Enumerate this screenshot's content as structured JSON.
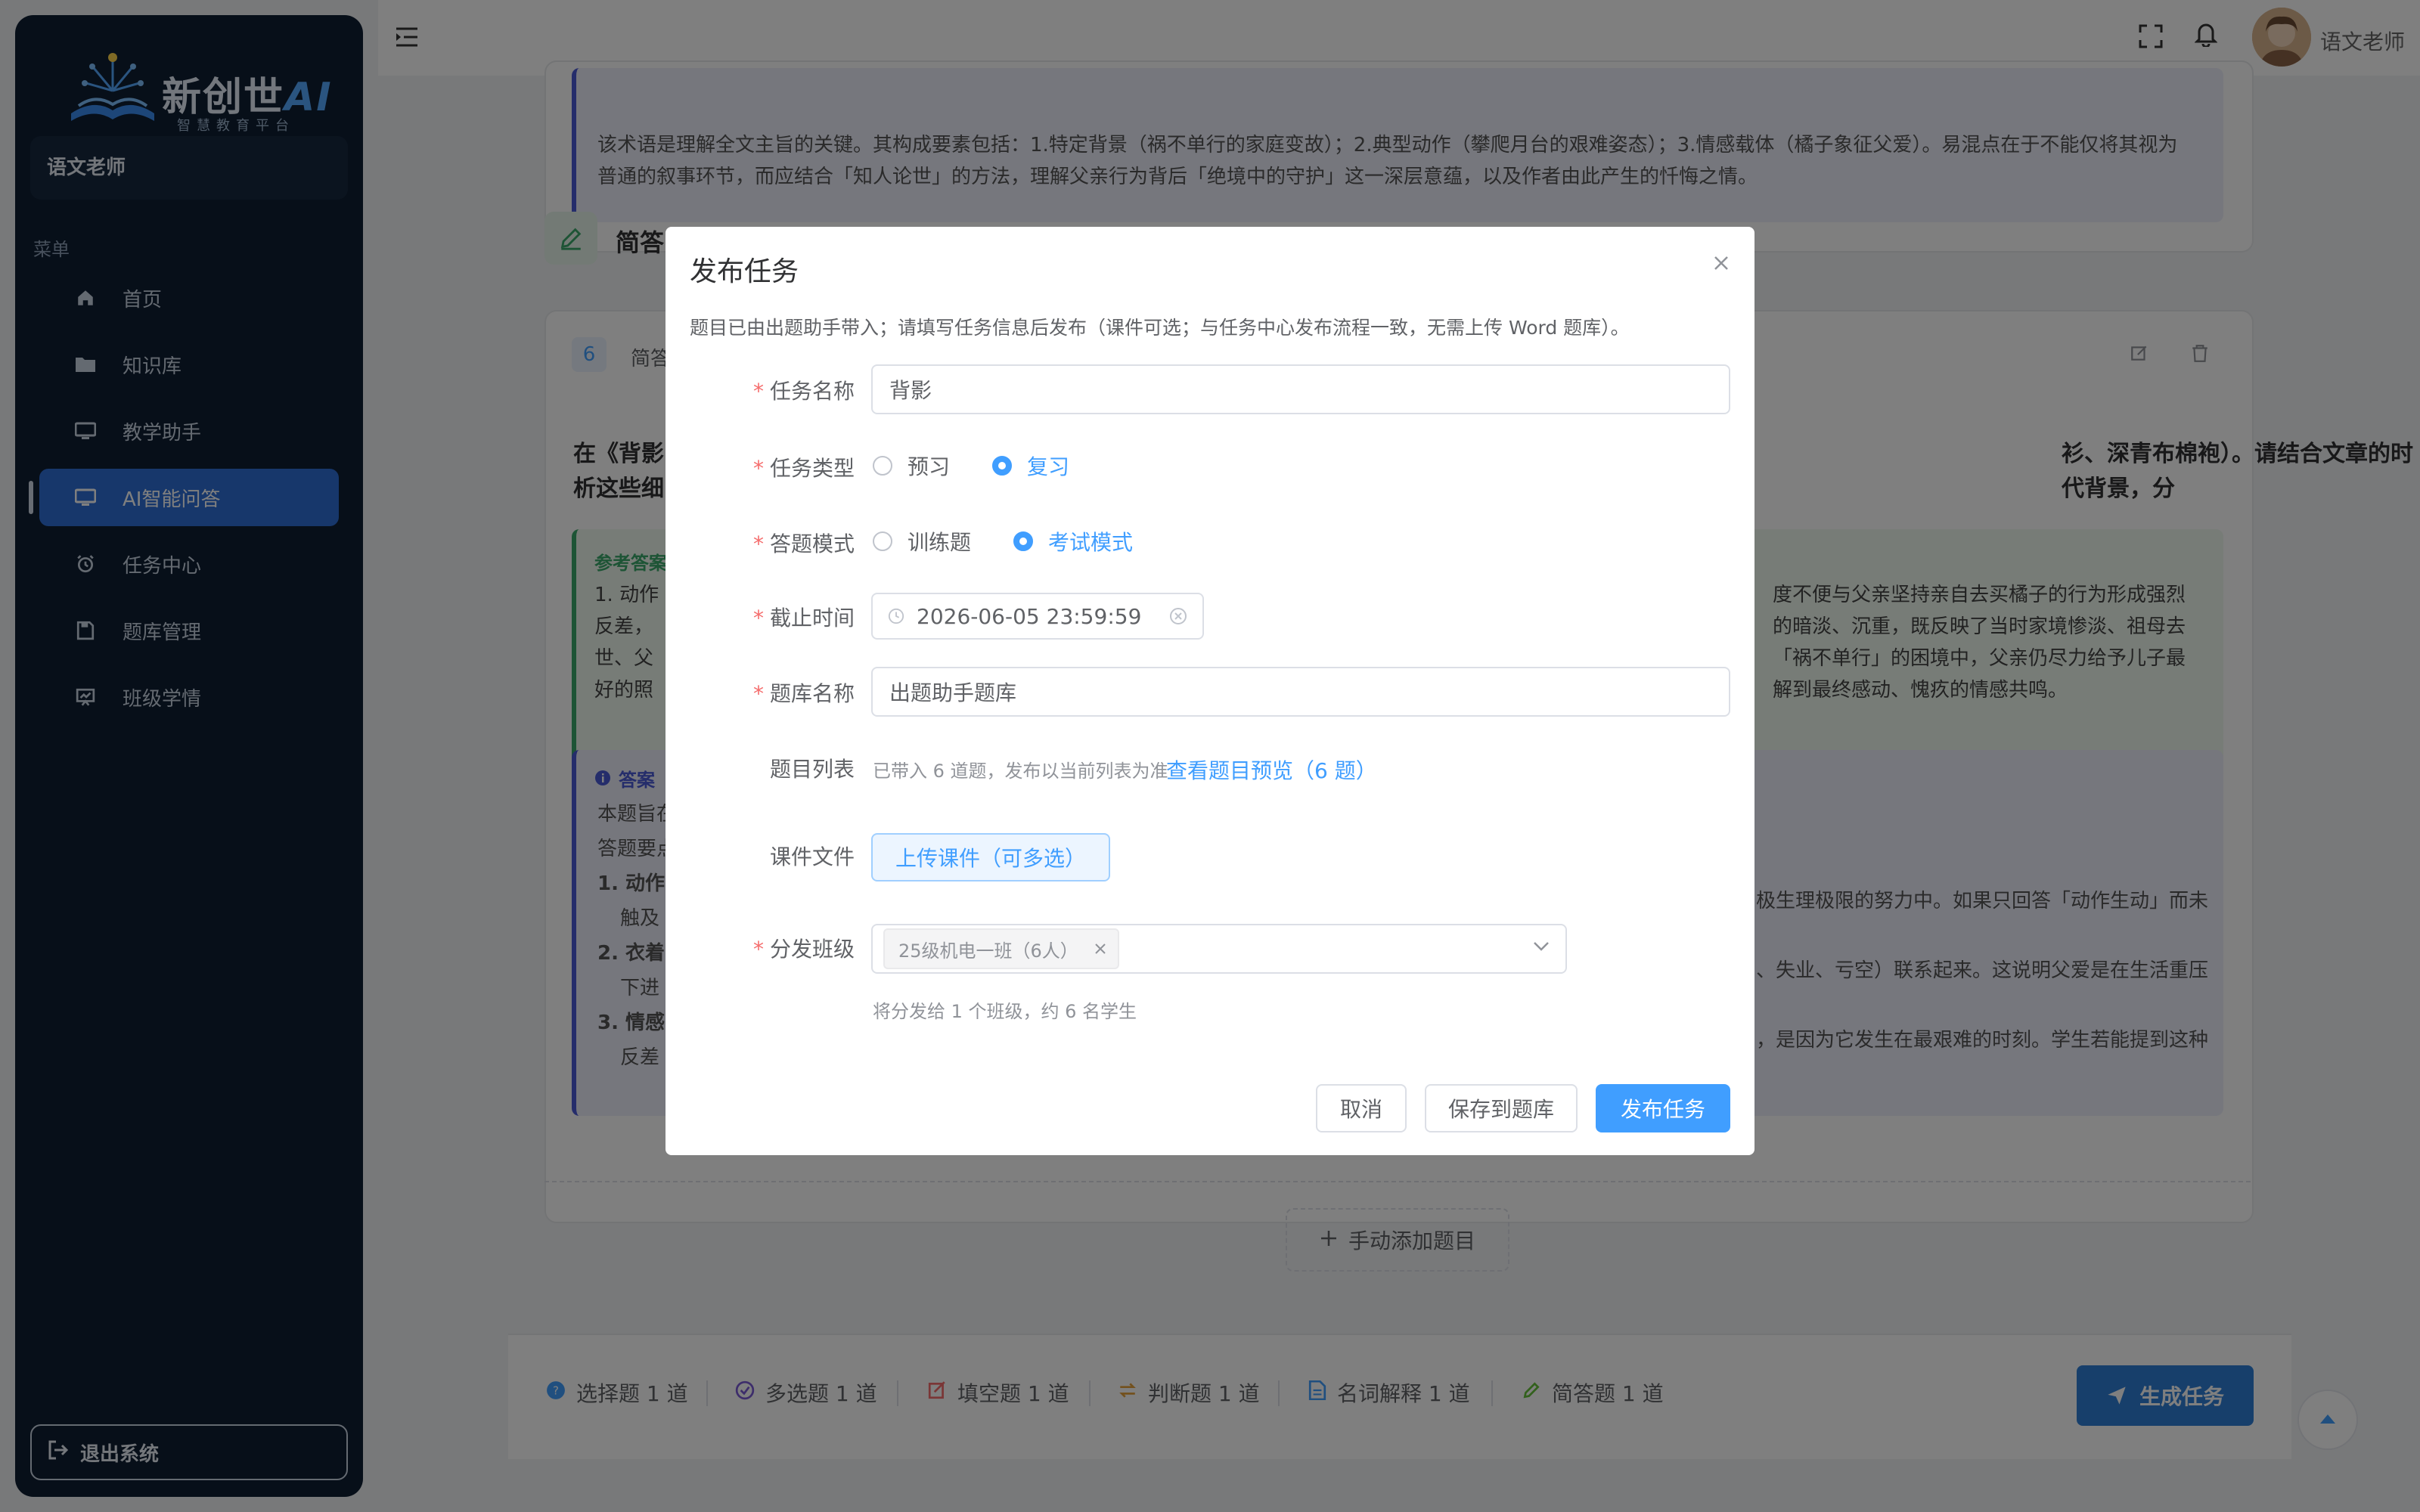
{
  "app": {
    "logo_text": "新创世",
    "logo_ai": "AI",
    "logo_subtitle": "智慧教育平台"
  },
  "user": {
    "role": "语文老师"
  },
  "sidebar": {
    "menu_label": "菜单",
    "items": [
      {
        "label": "首页",
        "icon": "home-icon"
      },
      {
        "label": "知识库",
        "icon": "folder-icon"
      },
      {
        "label": "教学助手",
        "icon": "monitor-icon"
      },
      {
        "label": "AI智能问答",
        "icon": "monitor-icon",
        "active": true
      },
      {
        "label": "任务中心",
        "icon": "alarm-clock-icon"
      },
      {
        "label": "题库管理",
        "icon": "save-icon"
      },
      {
        "label": "班级学情",
        "icon": "chart-board-icon"
      }
    ],
    "logout": "退出系统"
  },
  "topbar": {
    "username": "语文老师"
  },
  "background": {
    "note_line1": "该术语是理解全文主旨的关键。其构成要素包括：1.特定背景（祸不单行的家庭变故）；2.典型动作（攀爬月台的艰难姿态）；3.情感载体（橘子象征父爱）。易混点在于不能仅将其视为",
    "note_line2": "普通的叙事环节，而应结合「知人论世」的方法，理解父亲行为背后「绝境中的守护」这一深层意蕴，以及作者由此产生的忏悔之情。",
    "section_title": "简答",
    "question_number": "6",
    "question_type": "简答",
    "question_left_1": "在《背影",
    "question_left_2": "析这些细",
    "question_right_1": "衫、深青布棉袍）。请结合文章的时代背景，分",
    "ref_answer_label": "参考答案",
    "ref_left": [
      "1. 动作",
      "反差，",
      "世、父",
      "好的照"
    ],
    "ref_right": [
      "度不便与父亲坚持亲自去买橘子的行为形成强烈",
      "的暗淡、沉重，既反映了当时家境惨淡、祖母去",
      "「祸不单行」的困境中，父亲仍尽力给予儿子最",
      "解到最终感动、愧疚的情感共鸣。"
    ],
    "analysis_label": "答案",
    "analysis_left": [
      "本题旨在",
      "答题要点",
      "1. 动作",
      "触及",
      "2. 衣着",
      "下进",
      "3. 情感",
      "反差"
    ],
    "analysis_right": [
      "极生理极限的努力中。如果只回答「动作生动」而未",
      "、失业、亏空）联系起来。这说明父爱是在生活重压",
      "，是因为它发生在最艰难的时刻。学生若能提到这种"
    ],
    "add_question": "手动添加题目"
  },
  "bottom_stats": [
    {
      "label": "选择题 1 道",
      "icon": "question-circle-icon",
      "color": "#409eff"
    },
    {
      "label": "多选题 1 道",
      "icon": "check-circle-icon",
      "color": "#7b5bd6"
    },
    {
      "label": "填空题 1 道",
      "icon": "edit-box-icon",
      "color": "#f56c6c"
    },
    {
      "label": "判断题 1 道",
      "icon": "switch-icon",
      "color": "#e6a23c"
    },
    {
      "label": "名词解释 1 道",
      "icon": "document-icon",
      "color": "#409eff"
    },
    {
      "label": "简答题 1 道",
      "icon": "pen-icon",
      "color": "#67c23a"
    }
  ],
  "generate_button": "生成任务",
  "dialog": {
    "title": "发布任务",
    "description": "题目已由出题助手带入；请填写任务信息后发布（课件可选；与任务中心发布流程一致，无需上传 Word 题库）。",
    "fields": {
      "task_name": {
        "label": "任务名称",
        "value": "背影"
      },
      "task_type": {
        "label": "任务类型",
        "options": [
          "预习",
          "复习"
        ],
        "selected": "复习"
      },
      "answer_mode": {
        "label": "答题模式",
        "options": [
          "训练题",
          "考试模式"
        ],
        "selected": "考试模式"
      },
      "deadline": {
        "label": "截止时间",
        "value": "2026-06-05 23:59:59"
      },
      "bank_name": {
        "label": "题库名称",
        "value": "出题助手题库"
      },
      "question_list": {
        "label": "题目列表",
        "info": "已带入 6 道题，发布以当前列表为准",
        "link": "查看题目预览（6 题）"
      },
      "courseware": {
        "label": "课件文件",
        "button": "上传课件（可多选）"
      },
      "classes": {
        "label": "分发班级",
        "tag": "25级机电一班（6人）",
        "hint": "将分发给 1 个班级，约 6 名学生"
      }
    },
    "buttons": {
      "cancel": "取消",
      "save": "保存到题库",
      "publish": "发布任务"
    }
  }
}
